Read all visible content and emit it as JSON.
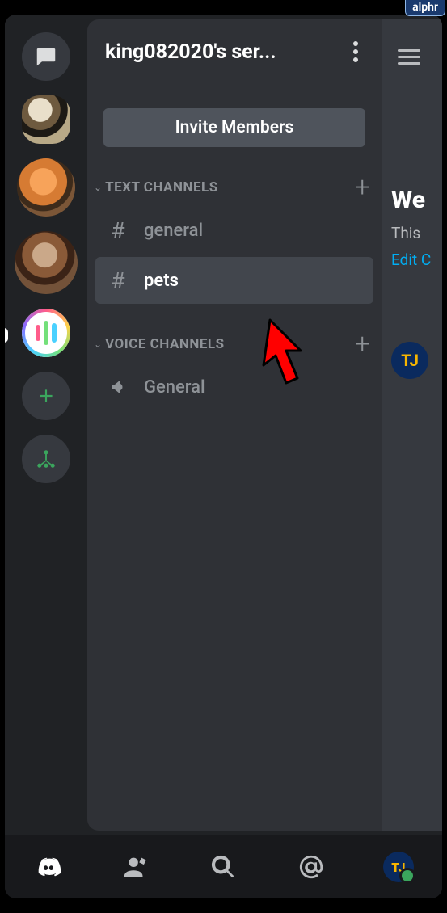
{
  "watermark": "alphr",
  "server_rail": {
    "dm_icon": "dm-icon",
    "servers": [
      {
        "name": "dog-puppy",
        "icon": "avatar-dog1"
      },
      {
        "name": "orange-cat",
        "icon": "avatar-cat"
      },
      {
        "name": "dachshund",
        "icon": "avatar-dog2"
      },
      {
        "name": "voice-bars",
        "icon": "avatar-bars"
      }
    ],
    "add_label": "Add Server",
    "discover_label": "Discover"
  },
  "header": {
    "server_title": "king082020's ser..."
  },
  "invite_button_label": "Invite Members",
  "sections": [
    {
      "id": "text",
      "title": "TEXT CHANNELS",
      "channels": [
        {
          "name": "general",
          "icon": "hash",
          "selected": false
        },
        {
          "name": "pets",
          "icon": "hash",
          "selected": true
        }
      ]
    },
    {
      "id": "voice",
      "title": "VOICE CHANNELS",
      "channels": [
        {
          "name": "General",
          "icon": "speaker",
          "selected": false
        }
      ]
    }
  ],
  "peek": {
    "heading": "We",
    "subtitle": "This",
    "edit_link": "Edit C",
    "avatar_text": "TJ"
  },
  "tabs": {
    "home": "home",
    "friends": "friends",
    "search": "search",
    "mentions": "mentions",
    "profile_text": "TJ"
  },
  "annotation": {
    "cursor_points_to": "channel-pets"
  }
}
